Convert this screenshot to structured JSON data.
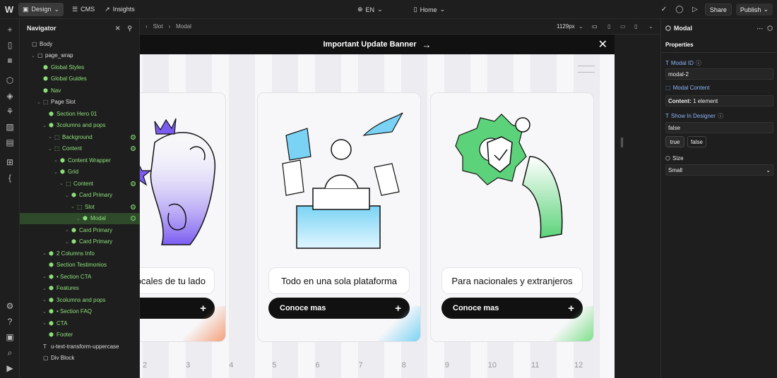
{
  "topbar": {
    "logo": "W",
    "mode_tabs": [
      {
        "label": "Design",
        "active": true
      },
      {
        "label": "CMS",
        "active": false
      },
      {
        "label": "Insights",
        "active": false
      }
    ],
    "locale": "EN",
    "page": "Home",
    "share_label": "Share",
    "publish_label": "Publish"
  },
  "navigator": {
    "title": "Navigator",
    "tree": [
      {
        "label": "Body",
        "depth": 0,
        "icon": "box",
        "white": true,
        "arrow": false
      },
      {
        "label": "page_wrap",
        "depth": 1,
        "icon": "box",
        "white": true,
        "arrow": true
      },
      {
        "label": "Global Styles",
        "depth": 2,
        "icon": "component",
        "arrow": false
      },
      {
        "label": "Global Guides",
        "depth": 2,
        "icon": "component",
        "arrow": false
      },
      {
        "label": "Nav",
        "depth": 2,
        "icon": "component",
        "arrow": false
      },
      {
        "label": "Page Slot",
        "depth": 2,
        "icon": "slot",
        "white": true,
        "arrow": true
      },
      {
        "label": "Section Hero 01",
        "depth": 3,
        "icon": "component",
        "arrow": false
      },
      {
        "label": "3columns and pops",
        "depth": 3,
        "icon": "component",
        "arrow": true
      },
      {
        "label": "Background",
        "depth": 4,
        "icon": "slot",
        "arrow": true,
        "dot": true
      },
      {
        "label": "Content",
        "depth": 4,
        "icon": "slot",
        "arrow": true,
        "dot": true
      },
      {
        "label": "Content Wrapper",
        "depth": 5,
        "icon": "component",
        "arrow": true
      },
      {
        "label": "Grid",
        "depth": 5,
        "icon": "component",
        "arrow": true
      },
      {
        "label": "Content",
        "depth": 6,
        "icon": "slot",
        "arrow": true,
        "dot": true
      },
      {
        "label": "Card Primary",
        "depth": 7,
        "icon": "component",
        "arrow": true
      },
      {
        "label": "Slot",
        "depth": 8,
        "icon": "slot",
        "arrow": true,
        "dot": true
      },
      {
        "label": "Modal",
        "depth": 9,
        "icon": "component",
        "arrow": true,
        "selected": true,
        "dot": true
      },
      {
        "label": "Card Primary",
        "depth": 7,
        "icon": "component",
        "arrow": true
      },
      {
        "label": "Card Primary",
        "depth": 7,
        "icon": "component",
        "arrow": true
      },
      {
        "label": "2 Columns Info",
        "depth": 3,
        "icon": "component",
        "arrow": true
      },
      {
        "label": "Section Testimonios",
        "depth": 3,
        "icon": "component",
        "arrow": false
      },
      {
        "label": "• Section CTA",
        "depth": 3,
        "icon": "component",
        "arrow": true
      },
      {
        "label": "Features",
        "depth": 3,
        "icon": "component",
        "arrow": true
      },
      {
        "label": "3columns and pops",
        "depth": 3,
        "icon": "component",
        "arrow": true
      },
      {
        "label": "• Section FAQ",
        "depth": 3,
        "icon": "component",
        "arrow": true
      },
      {
        "label": "CTA",
        "depth": 3,
        "icon": "component",
        "arrow": true
      },
      {
        "label": "Footer",
        "depth": 3,
        "icon": "component",
        "arrow": false
      },
      {
        "label": "u-text-transform-uppercase",
        "depth": 2,
        "icon": "text",
        "white": true,
        "arrow": false
      },
      {
        "label": "Div Block",
        "depth": 2,
        "icon": "box",
        "white": true,
        "arrow": false
      }
    ]
  },
  "canvas_bar": {
    "breadcrumb": [
      "Slot",
      "Modal"
    ],
    "width_label": "1129px"
  },
  "canvas": {
    "banner": "Important Update Banner",
    "cards": [
      {
        "title": "s locales de tu lado",
        "button": "mas",
        "accent": "#f4a07a"
      },
      {
        "title": "Todo en una sola plataforma",
        "button": "Conoce mas",
        "accent": "#7ad3f4"
      },
      {
        "title": "Para nacionales y extranjeros",
        "button": "Conoce mas",
        "accent": "#7de08a"
      }
    ],
    "column_numbers": [
      "2",
      "3",
      "4",
      "5",
      "6",
      "7",
      "8",
      "9",
      "10",
      "11",
      "12"
    ]
  },
  "properties": {
    "component_name": "Modal",
    "tab": "Properties",
    "modal_id_label": "Modal ID",
    "modal_id_value": "modal-2",
    "modal_content_label": "Modal Content",
    "content_prefix": "Content:",
    "content_value": "1 element",
    "show_in_designer_label": "Show In Designer",
    "show_in_designer_value": "false",
    "toggle_true": "true",
    "toggle_false": "false",
    "size_label": "Size",
    "size_value": "Small"
  }
}
